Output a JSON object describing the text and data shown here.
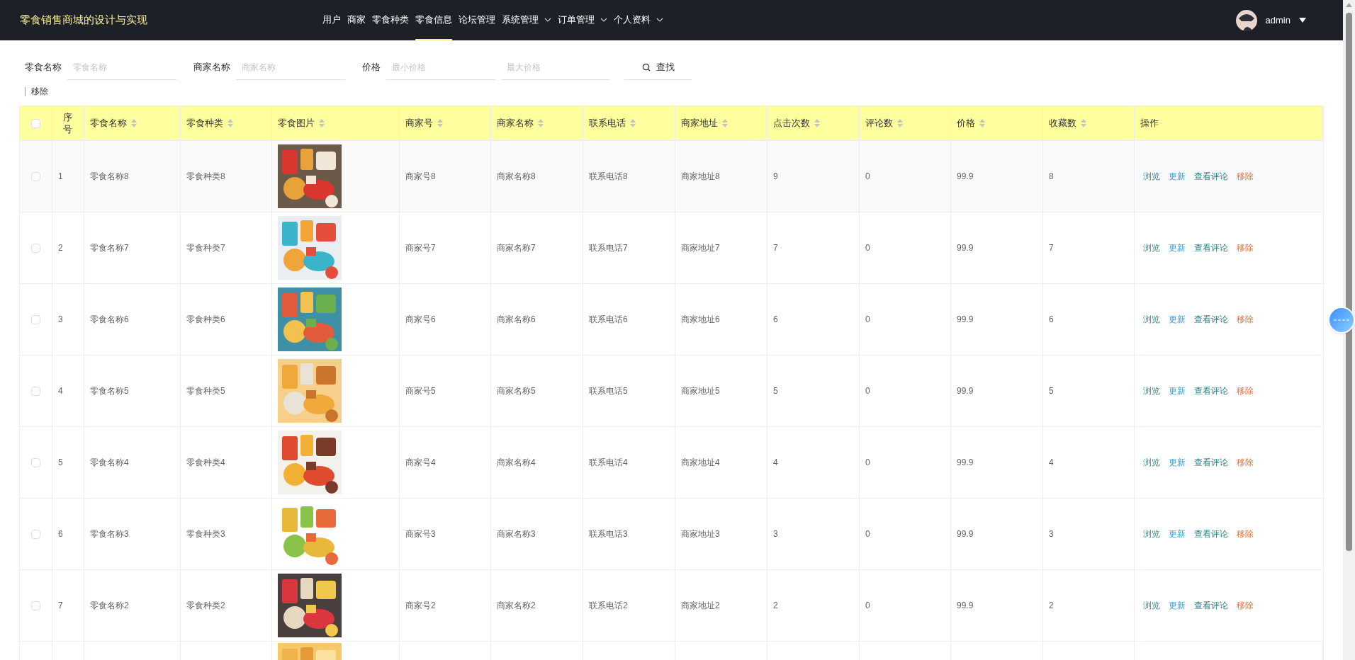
{
  "header": {
    "title": "零食销售商城的设计与实现",
    "nav": [
      {
        "label": "用户",
        "selected": false,
        "dropdown": false
      },
      {
        "label": "商家",
        "selected": false,
        "dropdown": false
      },
      {
        "label": "零食种类",
        "selected": false,
        "dropdown": false
      },
      {
        "label": "零食信息",
        "selected": true,
        "dropdown": false
      },
      {
        "label": "论坛管理",
        "selected": false,
        "dropdown": false
      },
      {
        "label": "系统管理",
        "selected": false,
        "dropdown": true
      },
      {
        "label": "订单管理",
        "selected": false,
        "dropdown": true
      },
      {
        "label": "个人资料",
        "selected": false,
        "dropdown": true
      }
    ],
    "user": {
      "name": "admin"
    }
  },
  "search": {
    "fields": [
      {
        "label": "零食名称",
        "inputs": [
          {
            "placeholder": "零食名称"
          }
        ]
      },
      {
        "label": "商家名称",
        "inputs": [
          {
            "placeholder": "商家名称"
          }
        ]
      },
      {
        "label": "价格",
        "inputs": [
          {
            "placeholder": "最小价格"
          },
          {
            "placeholder": "最大价格"
          }
        ]
      }
    ],
    "button": "查找",
    "remove": "移除"
  },
  "table": {
    "select_all": {
      "checked": false
    },
    "columns": [
      {
        "label": "序号",
        "sortable": false
      },
      {
        "label": "零食名称",
        "sortable": true
      },
      {
        "label": "零食种类",
        "sortable": true
      },
      {
        "label": "零食图片",
        "sortable": true
      },
      {
        "label": "商家号",
        "sortable": true
      },
      {
        "label": "商家名称",
        "sortable": true
      },
      {
        "label": "联系电话",
        "sortable": true
      },
      {
        "label": "商家地址",
        "sortable": true
      },
      {
        "label": "点击次数",
        "sortable": true
      },
      {
        "label": "评论数",
        "sortable": true
      },
      {
        "label": "价格",
        "sortable": true
      },
      {
        "label": "收藏数",
        "sortable": true
      },
      {
        "label": "操作",
        "sortable": false
      }
    ],
    "rows": [
      {
        "checked": false,
        "cells": [
          "1",
          "零食名称8",
          "零食种类8",
          null,
          "商家号8",
          "商家名称8",
          "联系电话8",
          "商家地址8",
          "9",
          "0",
          "99.9",
          "8"
        ],
        "picture": {
          "kind": "picture"
        },
        "actions": [
          {
            "label": "浏览",
            "kind": "view"
          },
          {
            "label": "更新",
            "kind": "edit"
          },
          {
            "label": "查看评论",
            "kind": "comments"
          },
          {
            "label": "移除",
            "kind": "delete"
          }
        ]
      },
      {
        "checked": false,
        "cells": [
          "2",
          "零食名称7",
          "零食种类7",
          null,
          "商家号7",
          "商家名称7",
          "联系电话7",
          "商家地址7",
          "7",
          "0",
          "99.9",
          "7"
        ],
        "picture": {
          "kind": "picture"
        },
        "actions": [
          {
            "label": "浏览",
            "kind": "view"
          },
          {
            "label": "更新",
            "kind": "edit"
          },
          {
            "label": "查看评论",
            "kind": "comments"
          },
          {
            "label": "移除",
            "kind": "delete"
          }
        ]
      },
      {
        "checked": false,
        "cells": [
          "3",
          "零食名称6",
          "零食种类6",
          null,
          "商家号6",
          "商家名称6",
          "联系电话6",
          "商家地址6",
          "6",
          "0",
          "99.9",
          "6"
        ],
        "picture": {
          "kind": "picture"
        },
        "actions": [
          {
            "label": "浏览",
            "kind": "view"
          },
          {
            "label": "更新",
            "kind": "edit"
          },
          {
            "label": "查看评论",
            "kind": "comments"
          },
          {
            "label": "移除",
            "kind": "delete"
          }
        ]
      },
      {
        "checked": false,
        "cells": [
          "4",
          "零食名称5",
          "零食种类5",
          null,
          "商家号5",
          "商家名称5",
          "联系电话5",
          "商家地址5",
          "5",
          "0",
          "99.9",
          "5"
        ],
        "picture": {
          "kind": "picture"
        },
        "actions": [
          {
            "label": "浏览",
            "kind": "view"
          },
          {
            "label": "更新",
            "kind": "edit"
          },
          {
            "label": "查看评论",
            "kind": "comments"
          },
          {
            "label": "移除",
            "kind": "delete"
          }
        ]
      },
      {
        "checked": false,
        "cells": [
          "5",
          "零食名称4",
          "零食种类4",
          null,
          "商家号4",
          "商家名称4",
          "联系电话4",
          "商家地址4",
          "4",
          "0",
          "99.9",
          "4"
        ],
        "picture": {
          "kind": "picture"
        },
        "actions": [
          {
            "label": "浏览",
            "kind": "view"
          },
          {
            "label": "更新",
            "kind": "edit"
          },
          {
            "label": "查看评论",
            "kind": "comments"
          },
          {
            "label": "移除",
            "kind": "delete"
          }
        ]
      },
      {
        "checked": false,
        "cells": [
          "6",
          "零食名称3",
          "零食种类3",
          null,
          "商家号3",
          "商家名称3",
          "联系电话3",
          "商家地址3",
          "3",
          "0",
          "99.9",
          "3"
        ],
        "picture": {
          "kind": "picture"
        },
        "actions": [
          {
            "label": "浏览",
            "kind": "view"
          },
          {
            "label": "更新",
            "kind": "edit"
          },
          {
            "label": "查看评论",
            "kind": "comments"
          },
          {
            "label": "移除",
            "kind": "delete"
          }
        ]
      },
      {
        "checked": false,
        "cells": [
          "7",
          "零食名称2",
          "零食种类2",
          null,
          "商家号2",
          "商家名称2",
          "联系电话2",
          "商家地址2",
          "2",
          "0",
          "99.9",
          "2"
        ],
        "picture": {
          "kind": "picture"
        },
        "actions": [
          {
            "label": "浏览",
            "kind": "view"
          },
          {
            "label": "更新",
            "kind": "edit"
          },
          {
            "label": "查看评论",
            "kind": "comments"
          },
          {
            "label": "移除",
            "kind": "delete"
          }
        ]
      }
    ]
  }
}
